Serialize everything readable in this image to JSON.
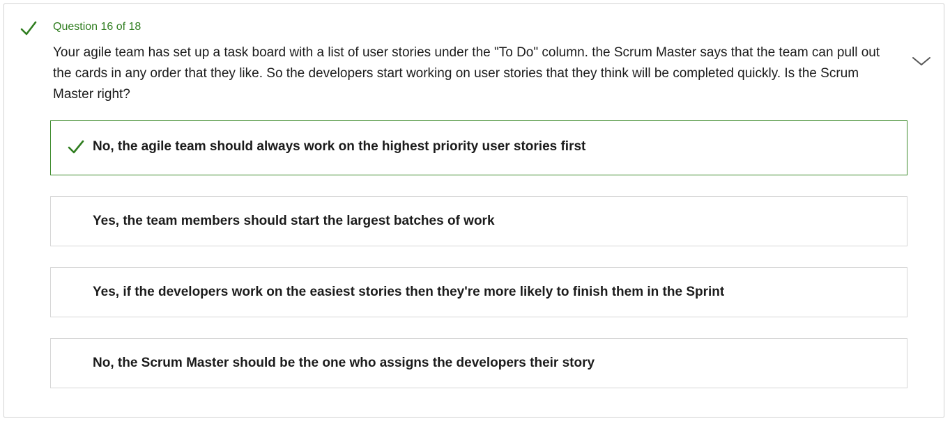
{
  "question": {
    "counter": "Question 16 of 18",
    "text": "Your agile team has set up a task board with a list of user stories under the \"To Do\" column. the Scrum Master says that the team can pull out the cards in any order that they like. So the developers start working on user stories that they think will be completed quickly. Is the Scrum Master right?",
    "status_icon": "checkmark-icon",
    "expand_icon": "chevron-down-icon"
  },
  "answers": [
    {
      "label": "No, the agile team should always work on the highest priority user stories first",
      "correct": true
    },
    {
      "label": "Yes, the team members should start the largest batches of work",
      "correct": false
    },
    {
      "label": "Yes, if the developers work on the easiest stories then they're more likely to finish them in the Sprint",
      "correct": false
    },
    {
      "label": "No, the Scrum Master should be the one who assigns the developers their story",
      "correct": false
    }
  ],
  "colors": {
    "accent_green": "#2f7d1f",
    "correct_border": "#3b8a2a",
    "border": "#d6d6d6",
    "text": "#1b1b1b"
  }
}
